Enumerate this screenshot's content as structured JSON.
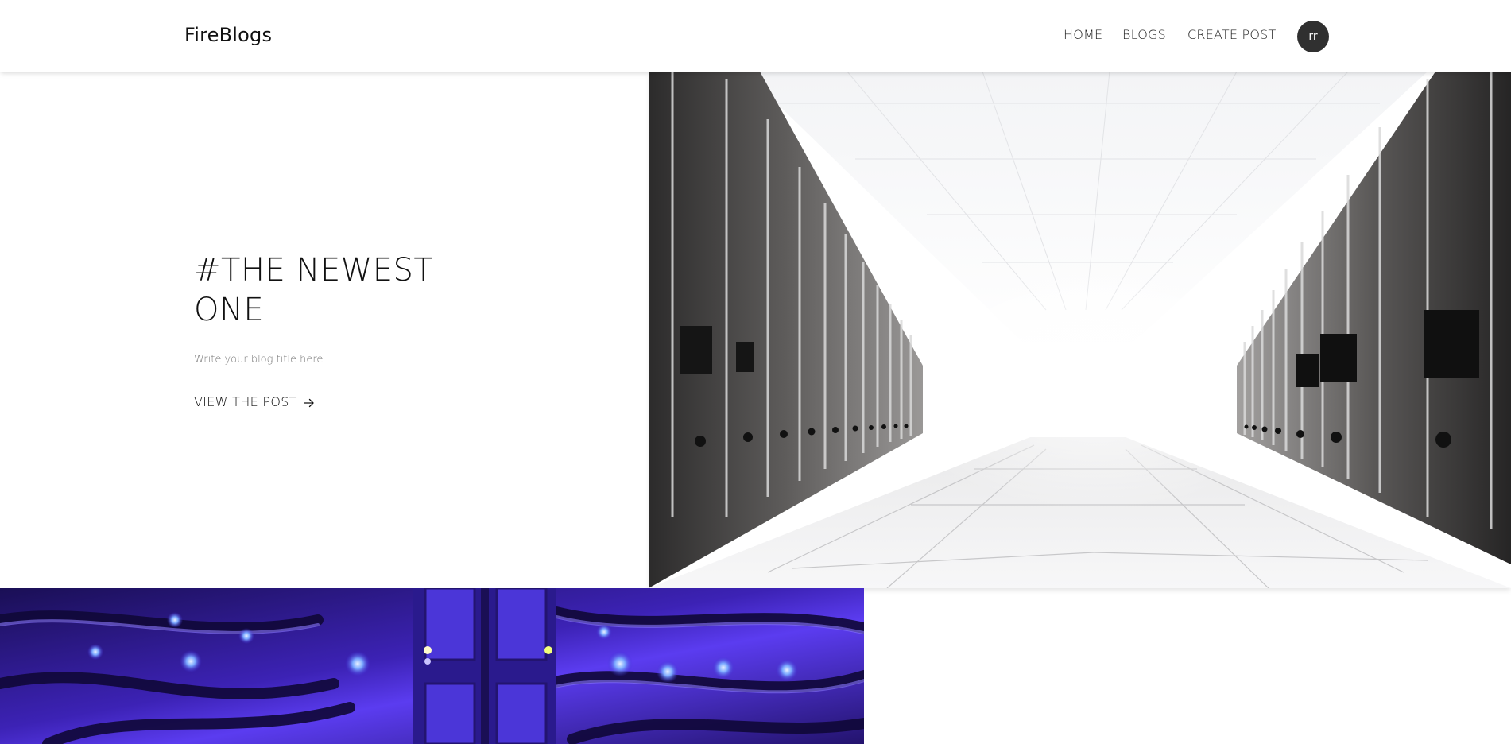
{
  "header": {
    "logo": "FireBlogs",
    "nav": {
      "home": "HOME",
      "blogs": "BLOGS",
      "create_post": "CREATE POST"
    },
    "avatar_initials": "rr"
  },
  "hero": {
    "title_line1": "#THE NEWEST",
    "title_line2": "ONE",
    "subtitle": "Write your blog title here...",
    "link_label": "VIEW THE POST",
    "link_icon": "arrow-right-icon",
    "image": "server-room-corridor-photo"
  },
  "card2": {
    "image": "blue-lit-network-cables-photo"
  },
  "colors": {
    "avatar_bg": "#303030",
    "card2_accent": "#5a3cff"
  }
}
